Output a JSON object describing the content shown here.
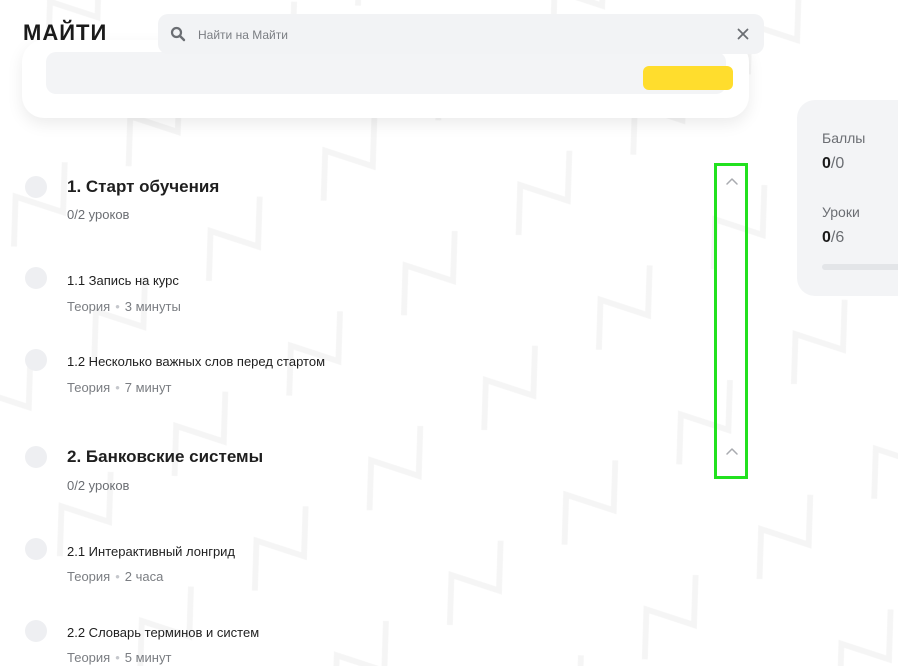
{
  "header": {
    "logo": "МАЙТИ",
    "search_placeholder": "Найти на Майти",
    "search_value": ""
  },
  "stats": {
    "points_label": "Баллы",
    "points_value": "0",
    "points_total": "/0",
    "lessons_label": "Уроки",
    "lessons_value": "0",
    "lessons_total": "/6",
    "progress_fraction": 0
  },
  "sections": [
    {
      "title": "1. Старт обучения",
      "count": "0/2 уроков",
      "lessons": [
        {
          "title": "1.1 Запись на курс",
          "type": "Теория",
          "duration": "3 минуты"
        },
        {
          "title": "1.2 Несколько важных слов перед стартом",
          "type": "Теория",
          "duration": "7 минут"
        }
      ]
    },
    {
      "title": "2. Банковские системы",
      "count": "0/2 уроков",
      "lessons": [
        {
          "title": "2.1 Интерактивный лонгрид",
          "type": "Теория",
          "duration": "2 часа"
        },
        {
          "title": "2.2 Словарь терминов и систем",
          "type": "Теория",
          "duration": "5 минут"
        }
      ]
    }
  ],
  "meta_separator": "•",
  "colors": {
    "accent": "#ffdd2d",
    "highlight": "#22e11f",
    "text": "#1f1f1f",
    "muted": "#7a7d82"
  }
}
